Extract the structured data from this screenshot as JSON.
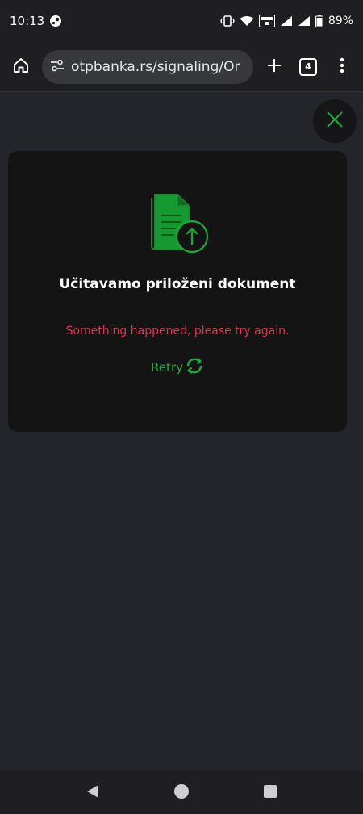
{
  "status_bar": {
    "time": "10:13",
    "battery": "89%"
  },
  "browser": {
    "url": "otpbanka.rs/signaling/Or",
    "tab_count": "4"
  },
  "card": {
    "title": "Učitavamo priloženi dokument",
    "error": "Something happened, please try again.",
    "retry_label": "Retry"
  },
  "colors": {
    "accent_green": "#22a83a",
    "error_red": "#e0344f",
    "card_bg": "#141414",
    "page_bg": "#24252a"
  },
  "icons": {
    "close": "close-icon",
    "document_upload": "document-upload-icon",
    "retry": "refresh-icon"
  }
}
